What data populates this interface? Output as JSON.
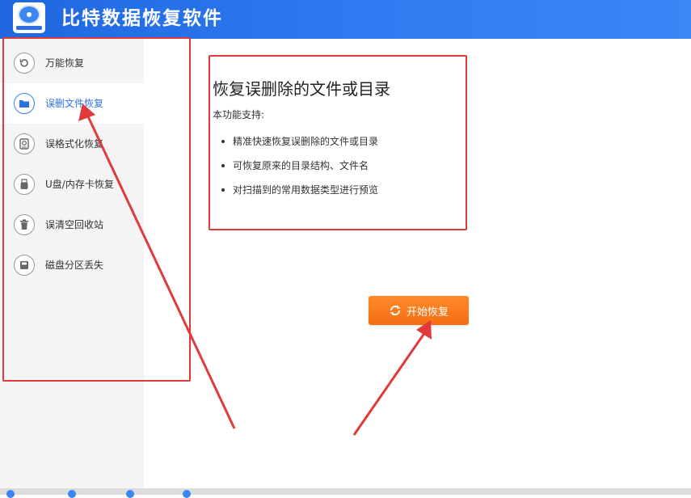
{
  "app": {
    "title": "比特数据恢复软件",
    "brand_color": "#2f7cf2"
  },
  "sidebar": {
    "items": [
      {
        "label": "万能恢复",
        "icon": "undo-icon",
        "active": false
      },
      {
        "label": "误删文件恢复",
        "icon": "folder-icon",
        "active": true
      },
      {
        "label": "误格式化恢复",
        "icon": "drive-icon",
        "active": false
      },
      {
        "label": "U盘/内存卡恢复",
        "icon": "usb-icon",
        "active": false
      },
      {
        "label": "误清空回收站",
        "icon": "trash-icon",
        "active": false
      },
      {
        "label": "磁盘分区丢失",
        "icon": "disk-icon",
        "active": false
      }
    ]
  },
  "content": {
    "title": "恢复误删除的文件或目录",
    "subtitle": "本功能支持:",
    "features": [
      "精准快速恢复误删除的文件或目录",
      "可恢复原来的目录结构、文件名",
      "对扫描到的常用数据类型进行预览"
    ]
  },
  "actions": {
    "start_label": "开始恢复",
    "start_color": "#f47a1f"
  },
  "annotations": {
    "highlight_color": "#e03a3a"
  }
}
